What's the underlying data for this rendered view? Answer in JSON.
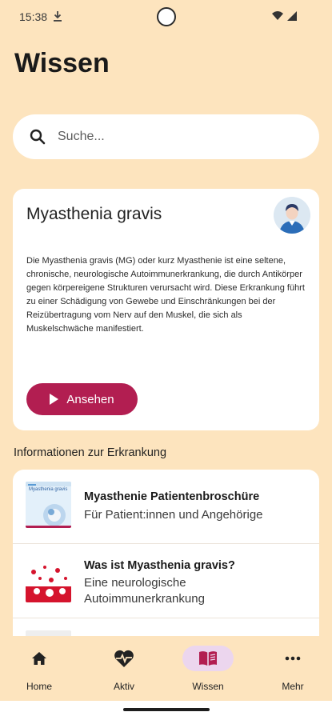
{
  "status": {
    "time": "15:38"
  },
  "page": {
    "title": "Wissen"
  },
  "search": {
    "placeholder": "Suche..."
  },
  "feature": {
    "title": "Myasthenia gravis",
    "description": "Die Myasthenia gravis (MG) oder kurz Myasthenie ist eine seltene, chronische, neurologische Autoimmunerkrankung, die durch Antikörper gegen körpereigene Strukturen verursacht wird. Diese Erkrankung führt zu einer Schädigung von Gewebe und Einschränkungen bei der Reizübertragung vom Nerv auf den Muskel, die sich als Muskelschwäche manifestiert.",
    "button_label": "Ansehen"
  },
  "section": {
    "title": "Informationen zur Erkrankung"
  },
  "info_items": [
    {
      "title": "Myasthenie Patientenbroschüre",
      "subtitle": "Für Patient:innen und Angehörige",
      "thumb_caption": "Myasthenia gravis"
    },
    {
      "title": "Was ist Myasthenia gravis?",
      "subtitle": "Eine neurologische Autoimmunerkrankung"
    }
  ],
  "nav": [
    {
      "label": "Home",
      "icon": "home-icon"
    },
    {
      "label": "Aktiv",
      "icon": "heart-pulse-icon"
    },
    {
      "label": "Wissen",
      "icon": "book-icon"
    },
    {
      "label": "Mehr",
      "icon": "more-icon"
    }
  ],
  "colors": {
    "background": "#fde4be",
    "accent": "#b21e51",
    "active_nav": "#ecd6ee"
  }
}
